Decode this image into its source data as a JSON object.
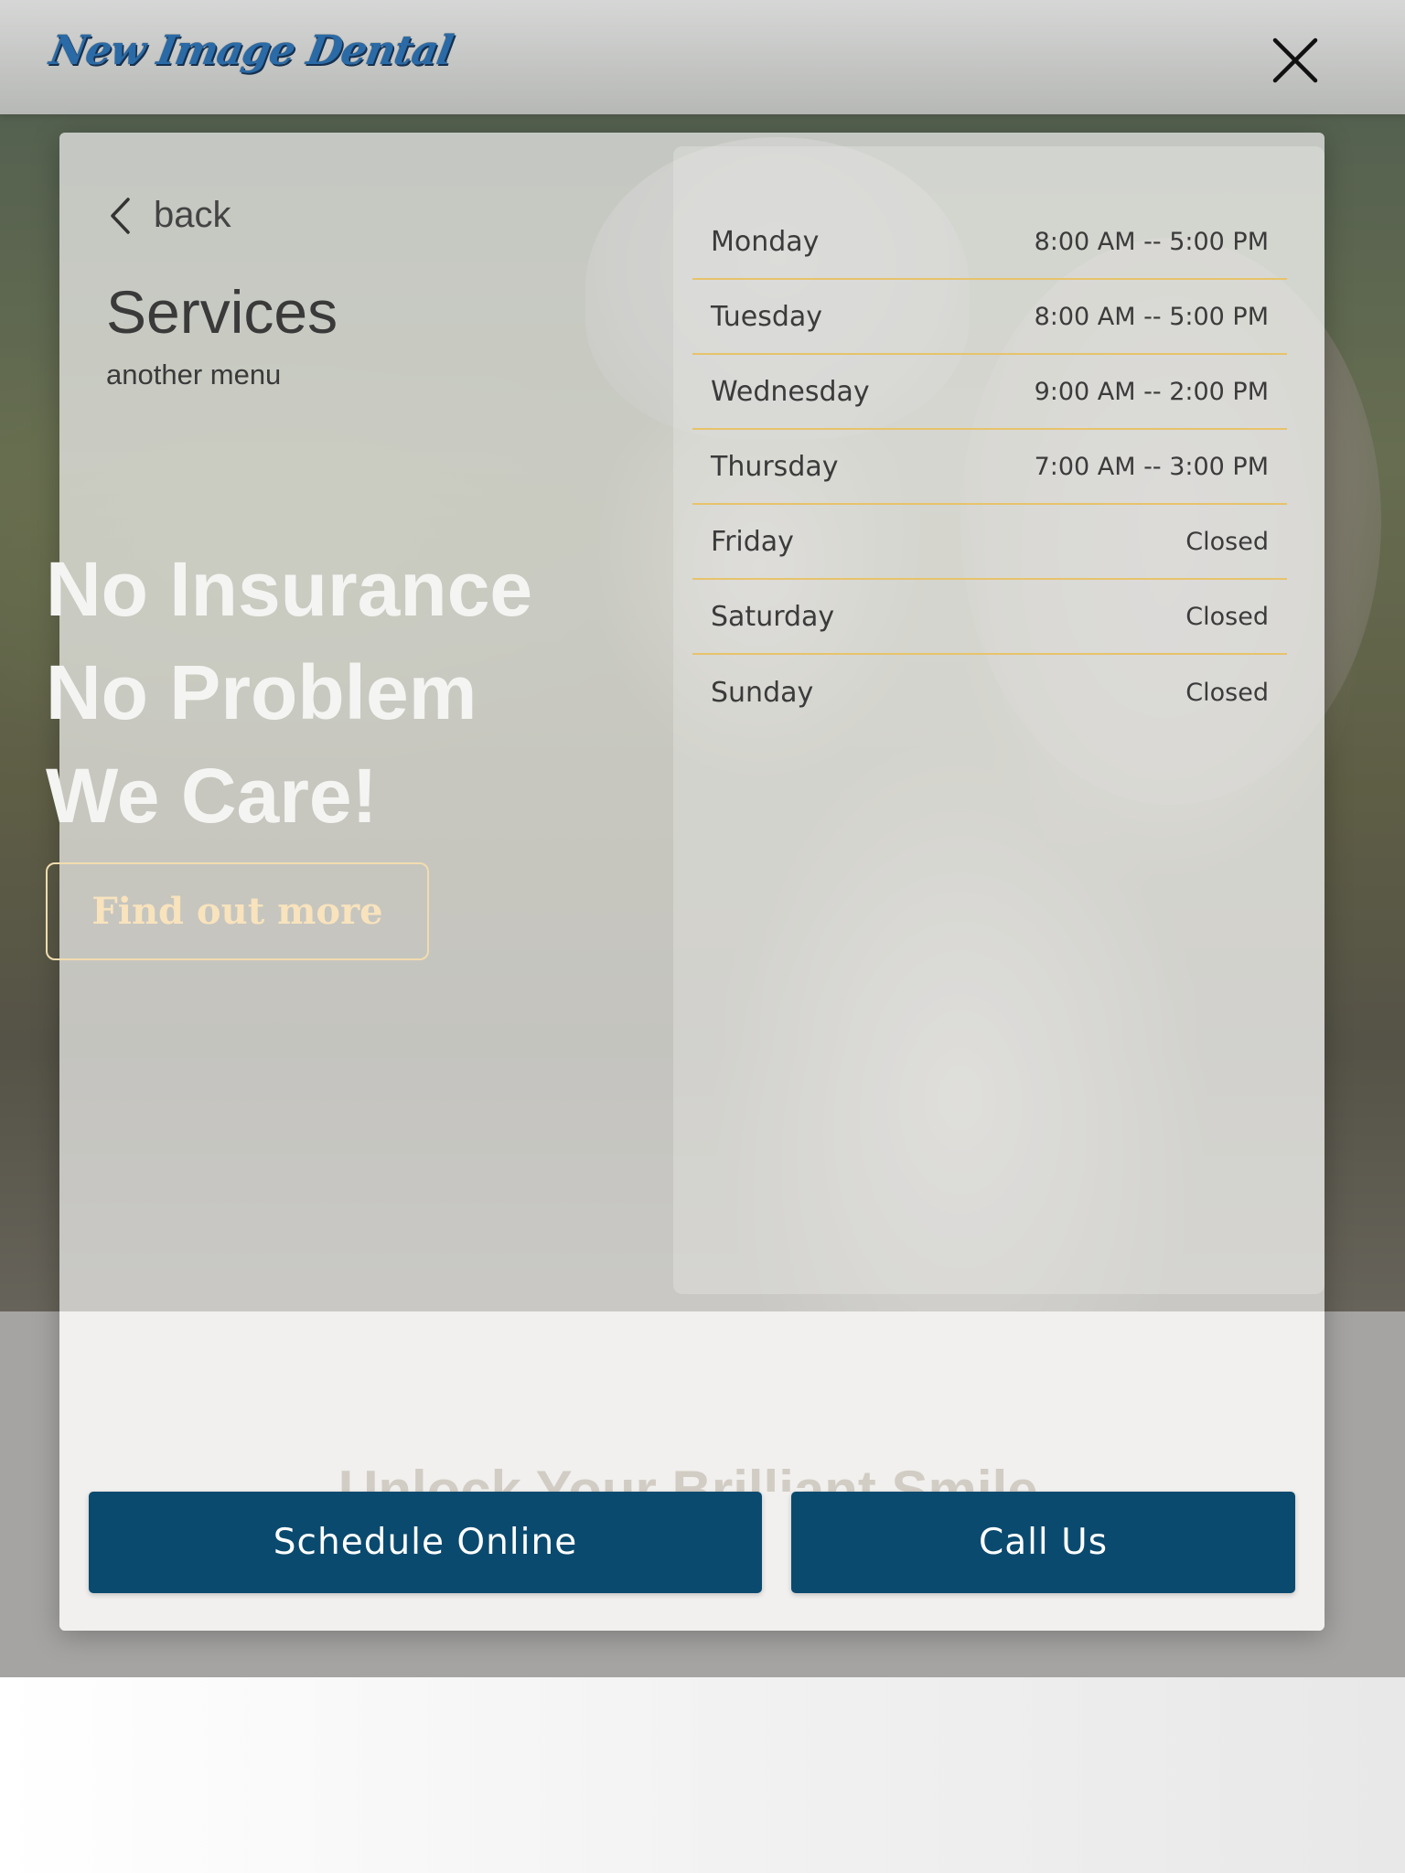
{
  "header": {
    "logo_text": "New Image Dental",
    "close_icon": "close-icon"
  },
  "menu": {
    "back_label": "back",
    "title": "Services",
    "subtitle": "another menu"
  },
  "hero": {
    "headline_lines": [
      "No Insurance",
      "No Problem",
      "We Care!"
    ],
    "cta_label": "Find out more",
    "section_heading": "Unlock Your Brilliant Smile"
  },
  "hours": [
    {
      "day": "Monday",
      "time": "8:00 AM -- 5:00 PM"
    },
    {
      "day": "Tuesday",
      "time": "8:00 AM -- 5:00 PM"
    },
    {
      "day": "Wednesday",
      "time": "9:00 AM -- 2:00 PM"
    },
    {
      "day": "Thursday",
      "time": "7:00 AM -- 3:00 PM"
    },
    {
      "day": "Friday",
      "time": "Closed"
    },
    {
      "day": "Saturday",
      "time": "Closed"
    },
    {
      "day": "Sunday",
      "time": "Closed"
    }
  ],
  "actions": {
    "schedule_label": "Schedule Online",
    "call_label": "Call Us"
  },
  "colors": {
    "primary_button": "#0b4a6f",
    "hours_divider": "#e7c36b",
    "find_out_more": "#f8e3bd"
  }
}
